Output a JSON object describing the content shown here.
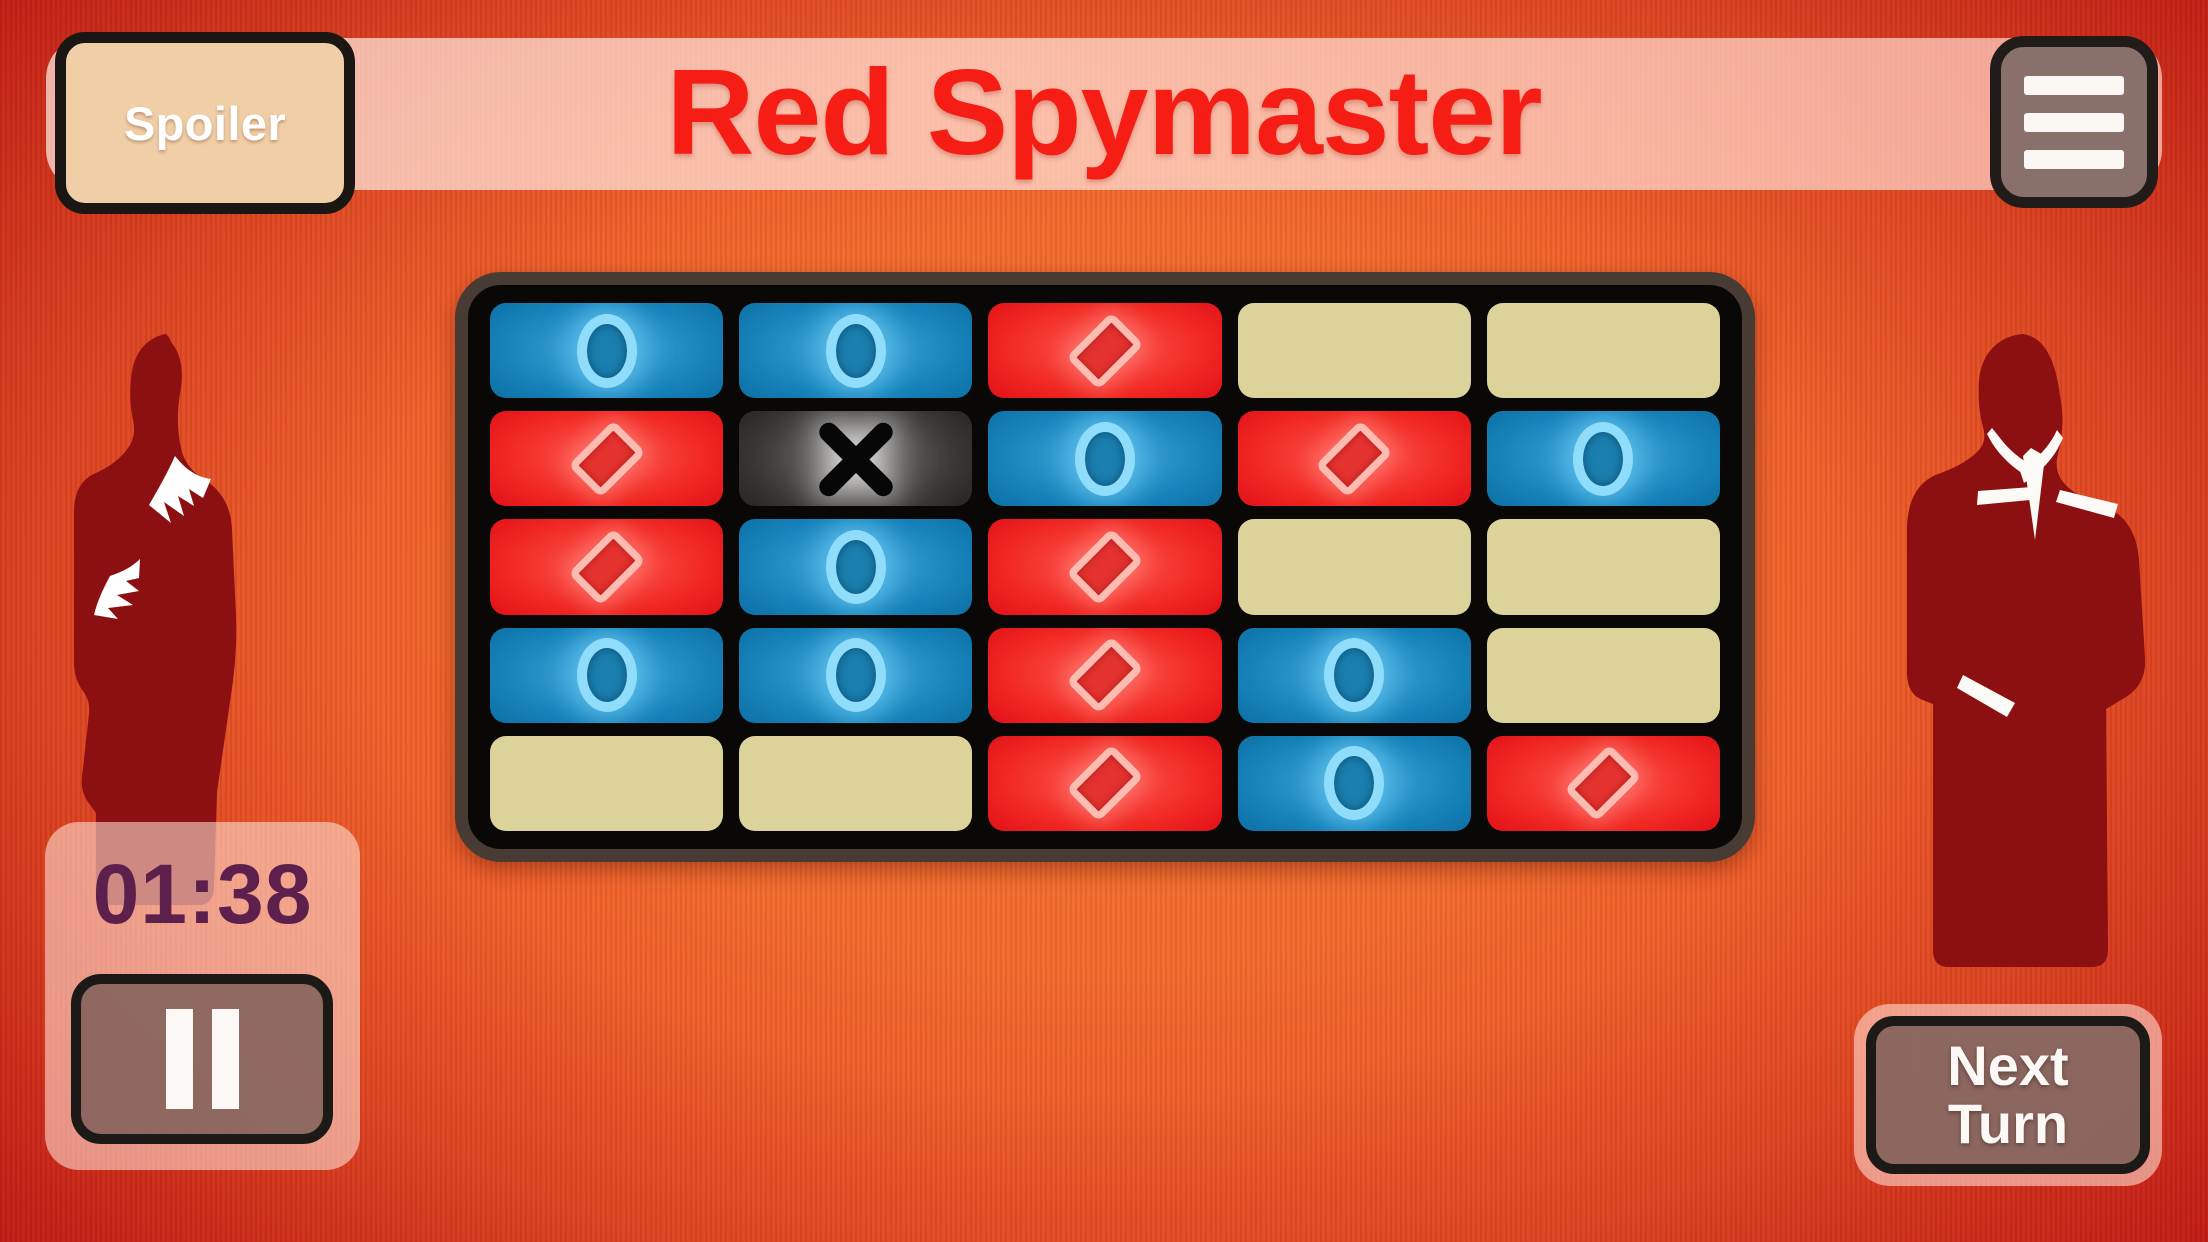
{
  "header": {
    "title": "Red Spymaster",
    "title_color": "#f51d14",
    "spoiler_label": "Spoiler",
    "menu_icon": "hamburger-menu-icon"
  },
  "timer": {
    "value": "01:38",
    "text_color": "#5d1f4c",
    "pause_icon": "pause-icon"
  },
  "next_turn": {
    "line1": "Next",
    "line2": "Turn"
  },
  "characters": {
    "left": "female-spy-silhouette",
    "right": "male-spy-silhouette"
  },
  "board": {
    "rows": 5,
    "columns": 5,
    "colors": {
      "blue": "#1683bb",
      "red": "#f02722",
      "neutral": "#dbd39a",
      "assassin": "#383533",
      "board_background": "#090807",
      "board_border": "#473b33"
    },
    "legend": {
      "blue": "circle-glyph",
      "red": "diamond-glyph",
      "neutral": "blank",
      "assassin": "x-glyph"
    },
    "cards": [
      {
        "row": 1,
        "col": 1,
        "team": "blue",
        "glyph": "circle"
      },
      {
        "row": 1,
        "col": 2,
        "team": "blue",
        "glyph": "circle"
      },
      {
        "row": 1,
        "col": 3,
        "team": "red",
        "glyph": "diamond"
      },
      {
        "row": 1,
        "col": 4,
        "team": "neutral",
        "glyph": "none"
      },
      {
        "row": 1,
        "col": 5,
        "team": "neutral",
        "glyph": "none"
      },
      {
        "row": 2,
        "col": 1,
        "team": "red",
        "glyph": "diamond"
      },
      {
        "row": 2,
        "col": 2,
        "team": "assassin",
        "glyph": "x"
      },
      {
        "row": 2,
        "col": 3,
        "team": "blue",
        "glyph": "circle"
      },
      {
        "row": 2,
        "col": 4,
        "team": "red",
        "glyph": "diamond"
      },
      {
        "row": 2,
        "col": 5,
        "team": "blue",
        "glyph": "circle"
      },
      {
        "row": 3,
        "col": 1,
        "team": "red",
        "glyph": "diamond"
      },
      {
        "row": 3,
        "col": 2,
        "team": "blue",
        "glyph": "circle"
      },
      {
        "row": 3,
        "col": 3,
        "team": "red",
        "glyph": "diamond"
      },
      {
        "row": 3,
        "col": 4,
        "team": "neutral",
        "glyph": "none"
      },
      {
        "row": 3,
        "col": 5,
        "team": "neutral",
        "glyph": "none"
      },
      {
        "row": 4,
        "col": 1,
        "team": "blue",
        "glyph": "circle"
      },
      {
        "row": 4,
        "col": 2,
        "team": "blue",
        "glyph": "circle"
      },
      {
        "row": 4,
        "col": 3,
        "team": "red",
        "glyph": "diamond"
      },
      {
        "row": 4,
        "col": 4,
        "team": "blue",
        "glyph": "circle"
      },
      {
        "row": 4,
        "col": 5,
        "team": "neutral",
        "glyph": "none"
      },
      {
        "row": 5,
        "col": 1,
        "team": "neutral",
        "glyph": "none"
      },
      {
        "row": 5,
        "col": 2,
        "team": "neutral",
        "glyph": "none"
      },
      {
        "row": 5,
        "col": 3,
        "team": "red",
        "glyph": "diamond"
      },
      {
        "row": 5,
        "col": 4,
        "team": "blue",
        "glyph": "circle"
      },
      {
        "row": 5,
        "col": 5,
        "team": "red",
        "glyph": "diamond"
      }
    ]
  }
}
